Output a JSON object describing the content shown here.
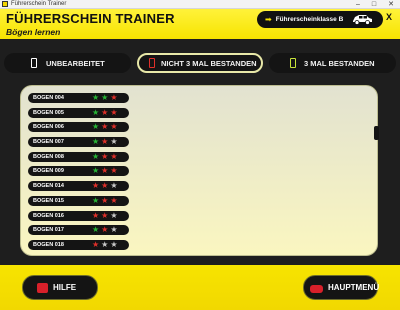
{
  "window": {
    "title": "Führerschein Trainer",
    "controls": [
      "–",
      "□",
      "✕"
    ]
  },
  "header": {
    "title": "FÜHRERSCHEIN TRAINER",
    "subtitle": "Bögen lernen",
    "class_label": "Führerscheinklasse B",
    "close_label": "X",
    "accent": "#f7e400"
  },
  "tabs": [
    {
      "label": "UNBEARBEITET",
      "icon": "white-page-icon",
      "active": false
    },
    {
      "label": "NICHT 3 MAL BESTANDEN",
      "icon": "red-page-icon",
      "active": true
    },
    {
      "label": "3 MAL BESTANDEN",
      "icon": "green-page-icon",
      "active": false
    }
  ],
  "star_colors": {
    "green": "#27b535",
    "red": "#e0302a",
    "grey": "#c9c9c9"
  },
  "bogen": [
    {
      "label": "BOGEN 004",
      "stars": [
        "green",
        "green",
        "red"
      ]
    },
    {
      "label": "BOGEN 005",
      "stars": [
        "green",
        "red",
        "red"
      ]
    },
    {
      "label": "BOGEN 006",
      "stars": [
        "green",
        "red",
        "red"
      ]
    },
    {
      "label": "BOGEN 007",
      "stars": [
        "green",
        "red",
        "grey"
      ]
    },
    {
      "label": "BOGEN 008",
      "stars": [
        "green",
        "red",
        "red"
      ]
    },
    {
      "label": "BOGEN 009",
      "stars": [
        "green",
        "red",
        "red"
      ]
    },
    {
      "label": "BOGEN 014",
      "stars": [
        "red",
        "red",
        "grey"
      ]
    },
    {
      "label": "BOGEN 015",
      "stars": [
        "green",
        "red",
        "red"
      ]
    },
    {
      "label": "BOGEN 016",
      "stars": [
        "red",
        "red",
        "grey"
      ]
    },
    {
      "label": "BOGEN 017",
      "stars": [
        "green",
        "red",
        "grey"
      ]
    },
    {
      "label": "BOGEN 018",
      "stars": [
        "red",
        "grey",
        "grey"
      ]
    }
  ],
  "footer": {
    "help_label": "HILFE",
    "main_label": "HAUPTMENÜ"
  }
}
